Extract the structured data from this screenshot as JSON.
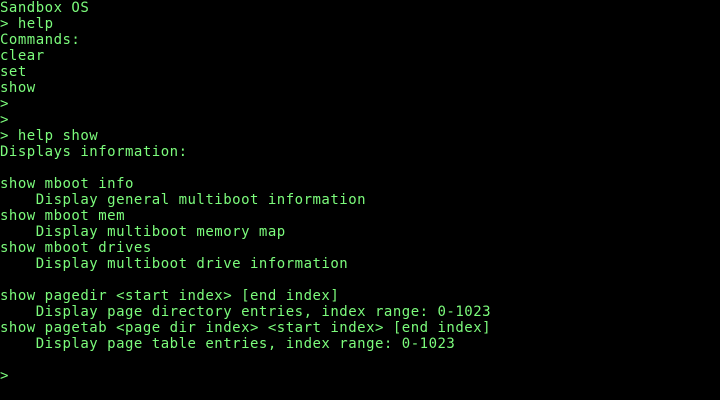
{
  "app_title": "Sandbox OS",
  "terminal": {
    "text_color": "#7CFC7C",
    "background_color": "#000000",
    "lines": [
      "> help",
      "Commands:",
      "clear",
      "set",
      "show",
      ">",
      ">",
      "> help show",
      "Displays information:",
      "",
      "show mboot info",
      "    Display general multiboot information",
      "show mboot mem",
      "    Display multiboot memory map",
      "show mboot drives",
      "    Display multiboot drive information",
      "",
      "show pagedir <start index> [end index]",
      "    Display page directory entries, index range: 0-1023",
      "show pagetab <page dir index> <start index> [end index]",
      "    Display page table entries, index range: 0-1023",
      ""
    ],
    "prompt": ">"
  }
}
